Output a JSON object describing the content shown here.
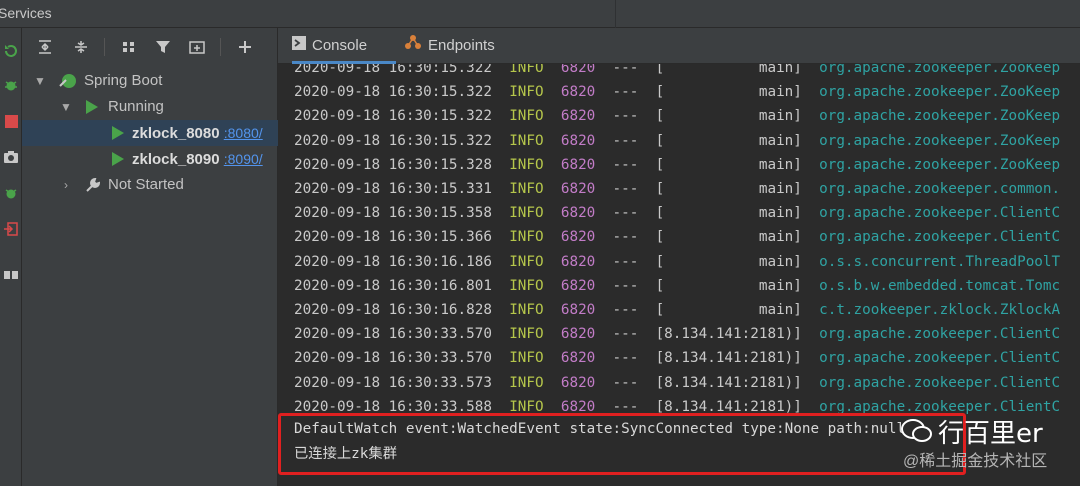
{
  "window": {
    "title": "Services"
  },
  "toolbar": {
    "icons": [
      "expand-all-icon",
      "collapse-all-icon",
      "group-icon",
      "filter-icon",
      "new-tab-icon",
      "add-icon"
    ]
  },
  "tree": {
    "root": "Spring Boot",
    "group_running": "Running",
    "services": [
      {
        "name": "zklock_8080",
        "port": ":8080/"
      },
      {
        "name": "zklock_8090",
        "port": ":8090/"
      }
    ],
    "group_not_started": "Not Started"
  },
  "tabs": [
    {
      "label": "Console"
    },
    {
      "label": "Endpoints"
    }
  ],
  "log": [
    {
      "date": "2020-09-18 16:30:15.322",
      "level": "INFO",
      "pid": "6820",
      "sep": "---",
      "thread": "[           main]",
      "logger": "org.apache.zookeeper.ZooKeep"
    },
    {
      "date": "2020-09-18 16:30:15.322",
      "level": "INFO",
      "pid": "6820",
      "sep": "---",
      "thread": "[           main]",
      "logger": "org.apache.zookeeper.ZooKeep"
    },
    {
      "date": "2020-09-18 16:30:15.322",
      "level": "INFO",
      "pid": "6820",
      "sep": "---",
      "thread": "[           main]",
      "logger": "org.apache.zookeeper.ZooKeep"
    },
    {
      "date": "2020-09-18 16:30:15.322",
      "level": "INFO",
      "pid": "6820",
      "sep": "---",
      "thread": "[           main]",
      "logger": "org.apache.zookeeper.ZooKeep"
    },
    {
      "date": "2020-09-18 16:30:15.328",
      "level": "INFO",
      "pid": "6820",
      "sep": "---",
      "thread": "[           main]",
      "logger": "org.apache.zookeeper.ZooKeep"
    },
    {
      "date": "2020-09-18 16:30:15.331",
      "level": "INFO",
      "pid": "6820",
      "sep": "---",
      "thread": "[           main]",
      "logger": "org.apache.zookeeper.common."
    },
    {
      "date": "2020-09-18 16:30:15.358",
      "level": "INFO",
      "pid": "6820",
      "sep": "---",
      "thread": "[           main]",
      "logger": "org.apache.zookeeper.ClientC"
    },
    {
      "date": "2020-09-18 16:30:15.366",
      "level": "INFO",
      "pid": "6820",
      "sep": "---",
      "thread": "[           main]",
      "logger": "org.apache.zookeeper.ClientC"
    },
    {
      "date": "2020-09-18 16:30:16.186",
      "level": "INFO",
      "pid": "6820",
      "sep": "---",
      "thread": "[           main]",
      "logger": "o.s.s.concurrent.ThreadPoolT"
    },
    {
      "date": "2020-09-18 16:30:16.801",
      "level": "INFO",
      "pid": "6820",
      "sep": "---",
      "thread": "[           main]",
      "logger": "o.s.b.w.embedded.tomcat.Tomc"
    },
    {
      "date": "2020-09-18 16:30:16.828",
      "level": "INFO",
      "pid": "6820",
      "sep": "---",
      "thread": "[           main]",
      "logger": "c.t.zookeeper.zklock.ZklockA"
    },
    {
      "date": "2020-09-18 16:30:33.570",
      "level": "INFO",
      "pid": "6820",
      "sep": "---",
      "thread": "[8.134.141:2181)]",
      "logger": "org.apache.zookeeper.ClientC"
    },
    {
      "date": "2020-09-18 16:30:33.570",
      "level": "INFO",
      "pid": "6820",
      "sep": "---",
      "thread": "[8.134.141:2181)]",
      "logger": "org.apache.zookeeper.ClientC"
    },
    {
      "date": "2020-09-18 16:30:33.573",
      "level": "INFO",
      "pid": "6820",
      "sep": "---",
      "thread": "[8.134.141:2181)]",
      "logger": "org.apache.zookeeper.ClientC"
    },
    {
      "date": "2020-09-18 16:30:33.588",
      "level": "INFO",
      "pid": "6820",
      "sep": "---",
      "thread": "[8.134.141:2181)]",
      "logger": "org.apache.zookeeper.ClientC"
    }
  ],
  "messages": [
    "DefaultWatch event:WatchedEvent state:SyncConnected type:None path:null",
    "已连接上zk集群"
  ],
  "watermark": {
    "title": "行百里er",
    "sub": "@稀土掘金技术社区"
  },
  "colors": {
    "level": "#b5c64b",
    "pid": "#c27cc7",
    "logger": "#2fa3a3",
    "highlight": "#e02020",
    "selection": "#2f4256"
  }
}
